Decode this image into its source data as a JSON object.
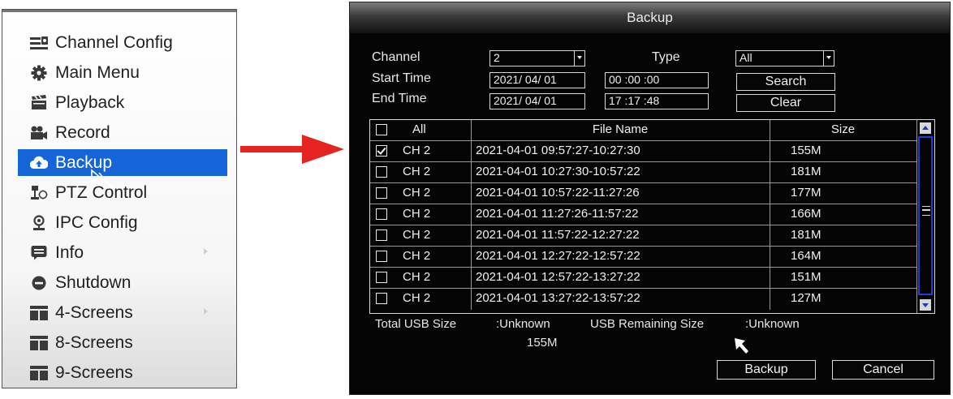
{
  "menu": {
    "items": [
      {
        "label": "Channel Config",
        "icon": "channel-config-icon"
      },
      {
        "label": "Main Menu",
        "icon": "gear-icon"
      },
      {
        "label": "Playback",
        "icon": "clapperboard-icon"
      },
      {
        "label": "Record",
        "icon": "camera-icon"
      },
      {
        "label": "Backup",
        "icon": "cloud-upload-icon"
      },
      {
        "label": "PTZ Control",
        "icon": "ptz-icon"
      },
      {
        "label": "IPC Config",
        "icon": "location-pin-icon"
      },
      {
        "label": "Info",
        "icon": "info-message-icon"
      },
      {
        "label": "Shutdown",
        "icon": "shutdown-icon"
      },
      {
        "label": "4-Screens",
        "icon": "screens-layout-icon"
      },
      {
        "label": "8-Screens",
        "icon": "screens-layout-icon"
      },
      {
        "label": "9-Screens",
        "icon": "screens-layout-icon"
      }
    ],
    "selected": "Backup",
    "selected_color": "#1665d8"
  },
  "arrow_color": "#e52421",
  "dialog": {
    "title": "Backup",
    "channel_label": "Channel",
    "channel_value": "2",
    "type_label": "Type",
    "type_value": "All",
    "start_time_label": "Start Time",
    "start_date": "2021/ 04/ 01",
    "start_time": "00 :00 :00",
    "end_time_label": "End Time",
    "end_date": "2021/ 04/ 01",
    "end_time": "17 :17 :48",
    "search_button": "Search",
    "clear_button": "Clear",
    "table": {
      "headers": {
        "select": "All",
        "file_name": "File Name",
        "size": "Size"
      },
      "rows": [
        {
          "channel": "CH 2",
          "file": "2021-04-01 09:57:27-10:27:30",
          "size": "155M",
          "checked": true
        },
        {
          "channel": "CH 2",
          "file": "2021-04-01 10:27:30-10:57:22",
          "size": "181M",
          "checked": false
        },
        {
          "channel": "CH 2",
          "file": "2021-04-01 10:57:22-11:27:26",
          "size": "177M",
          "checked": false
        },
        {
          "channel": "CH 2",
          "file": "2021-04-01 11:27:26-11:57:22",
          "size": "166M",
          "checked": false
        },
        {
          "channel": "CH 2",
          "file": "2021-04-01 11:57:22-12:27:22",
          "size": "181M",
          "checked": false
        },
        {
          "channel": "CH 2",
          "file": "2021-04-01 12:27:22-12:57:22",
          "size": "164M",
          "checked": false
        },
        {
          "channel": "CH 2",
          "file": "2021-04-01 12:57:22-13:27:22",
          "size": "151M",
          "checked": false
        },
        {
          "channel": "CH 2",
          "file": "2021-04-01 13:27:22-13:57:22",
          "size": "127M",
          "checked": false
        }
      ]
    },
    "total_usb_label": "Total USB Size",
    "total_usb_value": ":Unknown",
    "remaining_usb_label": "USB Remaining Size",
    "remaining_usb_value": ":Unknown",
    "selected_size": "155M",
    "backup_button": "Backup",
    "cancel_button": "Cancel",
    "scrollbar_color": "#1e3fd0"
  }
}
